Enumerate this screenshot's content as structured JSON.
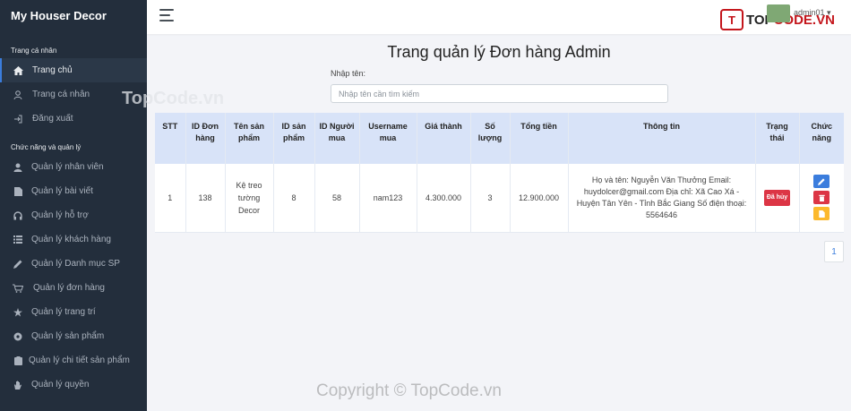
{
  "brand": "My Houser Decor",
  "sidebar": {
    "section1": "Trang cá nhân",
    "items1": [
      {
        "label": "Trang chủ",
        "icon": "home-icon"
      },
      {
        "label": "Trang cá nhân",
        "icon": "user-icon"
      },
      {
        "label": "Đăng xuất",
        "icon": "logout-icon"
      }
    ],
    "section2": "Chức năng và quản lý",
    "items2": [
      {
        "label": "Quản lý nhân viên",
        "icon": "user-icon"
      },
      {
        "label": "Quản lý bài viết",
        "icon": "document-icon"
      },
      {
        "label": "Quản lý hỗ trợ",
        "icon": "headphones-icon"
      },
      {
        "label": "Quản lý khách hàng",
        "icon": "list-icon"
      },
      {
        "label": "Quản lý Danh mục SP",
        "icon": "pencil-icon"
      },
      {
        "label": "Quản lý đơn hàng",
        "icon": "cart-icon"
      },
      {
        "label": "Quản lý trang trí",
        "icon": "star-icon"
      },
      {
        "label": "Quản lý sản phẩm",
        "icon": "box-icon"
      },
      {
        "label": "Quản lý chi tiết sản phẩm",
        "icon": "clipboard-icon"
      },
      {
        "label": "Quản lý quyền",
        "icon": "hand-icon"
      }
    ]
  },
  "topbar": {
    "username": "admin01",
    "logo_mark": "T",
    "logo_text_a": "TOP",
    "logo_text_b": "CODE.VN"
  },
  "main": {
    "title": "Trang quản lý Đơn hàng Admin",
    "search_label": "Nhập tên:",
    "search_placeholder": "Nhập tên cần tìm kiếm"
  },
  "table": {
    "headers": [
      "STT",
      "ID Đơn hàng",
      "Tên sản phẩm",
      "ID sản phẩm",
      "ID Người mua",
      "Username mua",
      "Giá thành",
      "Số lượng",
      "Tổng tiền",
      "Thông tin",
      "Trạng thái",
      "Chức năng"
    ],
    "rows": [
      {
        "stt": "1",
        "order_id": "138",
        "product_name": "Kệ treo tường Decor",
        "product_id": "8",
        "buyer_id": "58",
        "username": "nam123",
        "price": "4.300.000",
        "quantity": "3",
        "total": "12.900.000",
        "info": "Họ và tên: Nguyễn Văn Thưởng Email: huydolcer@gmail.com Địa chỉ: Xã Cao Xá - Huyện Tân Yên - Tỉnh Bắc Giang Số điện thoại: 5564646",
        "status": "Đã hủy"
      }
    ]
  },
  "pagination": {
    "current": "1"
  },
  "watermarks": {
    "top": "TopCode.vn",
    "bottom": "Copyright © TopCode.vn"
  },
  "colors": {
    "sidebar": "#232e3c",
    "accent": "#3b7ddd",
    "danger": "#dc3545",
    "warning": "#fcb92c",
    "header_row": "#d8e3f8"
  }
}
